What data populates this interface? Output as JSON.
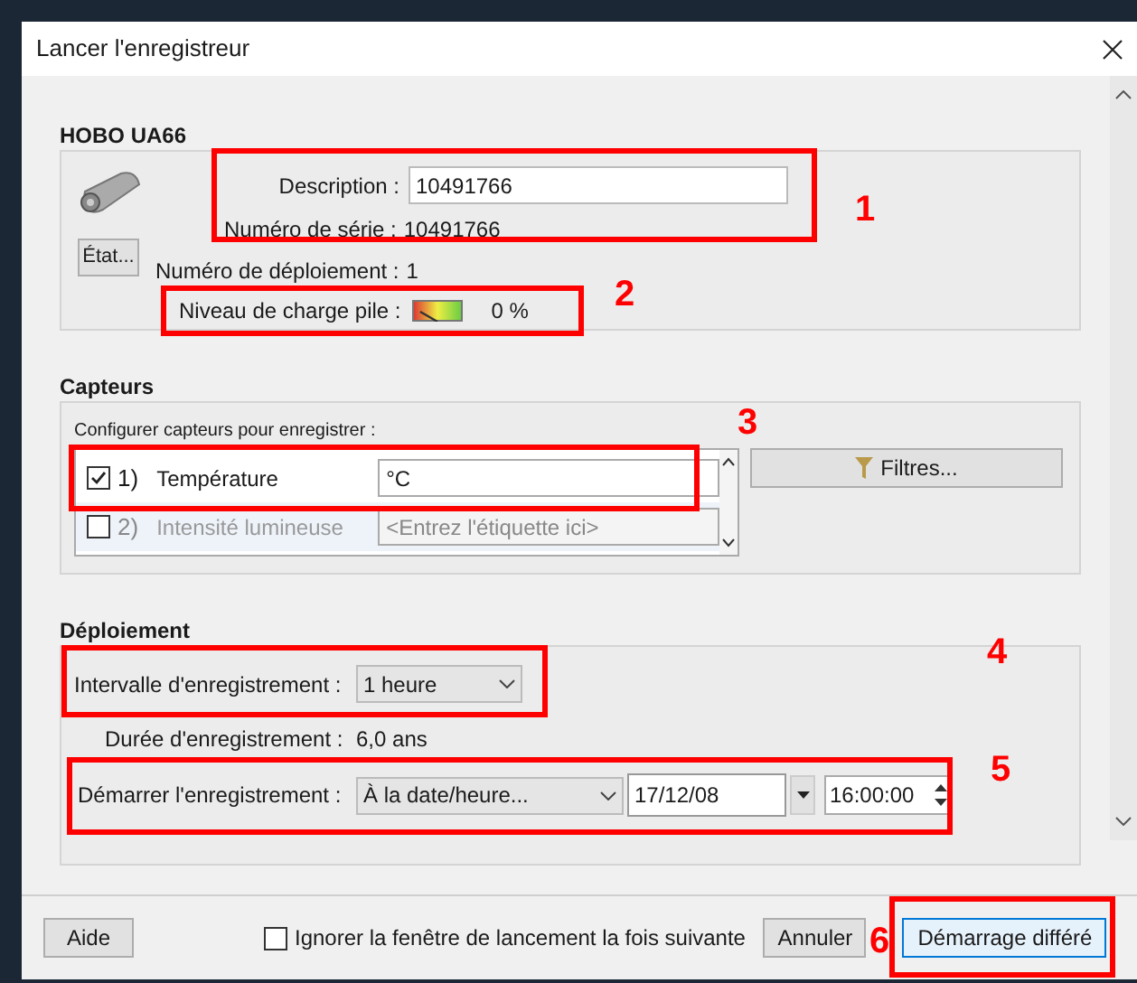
{
  "window": {
    "title": "Lancer l'enregistreur"
  },
  "device": {
    "name": "HOBO UA66",
    "status_button": "État...",
    "description_label": "Description :",
    "description": "10491766",
    "serial_label": "Numéro de série :",
    "serial": "10491766",
    "deployment_label": "Numéro de déploiement :",
    "deployment": "1",
    "battery_label": "Niveau de charge pile :",
    "battery": {
      "reading": "0 %"
    }
  },
  "sensors": {
    "title": "Capteurs",
    "hint": "Configurer capteurs pour enregistrer :",
    "filter_button": "Filtres...",
    "items": [
      {
        "index": "1)",
        "name": "Température",
        "label": "°C",
        "checked": true
      },
      {
        "index": "2)",
        "name": "Intensité lumineuse",
        "placeholder": "<Entrez l'étiquette ici>",
        "checked": false
      }
    ]
  },
  "deployment": {
    "title": "Déploiement",
    "interval_label": "Intervalle d'enregistrement :",
    "interval": "1 heure",
    "duration_label": "Durée d'enregistrement :",
    "duration": "6,0 ans",
    "start_label": "Démarrer l'enregistrement :",
    "start_mode": "À la date/heure...",
    "date": "17/12/08",
    "time": "16:00:00"
  },
  "footer": {
    "help": "Aide",
    "skip_label": "Ignorer la fenêtre de lancement la fois suivante",
    "skip_checked": false,
    "cancel": "Annuler",
    "start": "Démarrage différé"
  },
  "annotations": [
    "1",
    "2",
    "3",
    "4",
    "5",
    "6"
  ]
}
